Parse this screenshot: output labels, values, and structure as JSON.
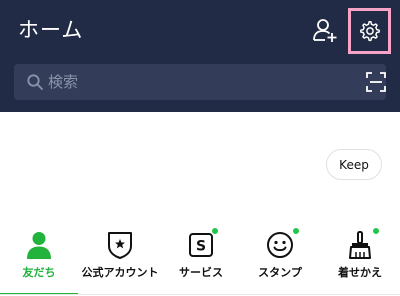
{
  "header": {
    "title": "ホーム",
    "add_friend_icon": "add-friend-icon",
    "settings_icon": "gear-icon",
    "highlight_color": "#f7a3c8",
    "background_color": "#222b45"
  },
  "search": {
    "placeholder": "検索",
    "search_icon": "search-icon",
    "scan_icon": "qr-scan-icon"
  },
  "keep": {
    "label": "Keep"
  },
  "tabs": {
    "accent_color": "#21b33b",
    "items": [
      {
        "label": "友だち",
        "icon": "person-icon",
        "active": true,
        "badge": false
      },
      {
        "label": "公式アカウント",
        "icon": "official-badge-icon",
        "active": false,
        "badge": false
      },
      {
        "label": "サービス",
        "icon": "service-s-icon",
        "active": false,
        "badge": true
      },
      {
        "label": "スタンプ",
        "icon": "smiley-icon",
        "active": false,
        "badge": true
      },
      {
        "label": "着せかえ",
        "icon": "brush-icon",
        "active": false,
        "badge": true
      }
    ]
  }
}
